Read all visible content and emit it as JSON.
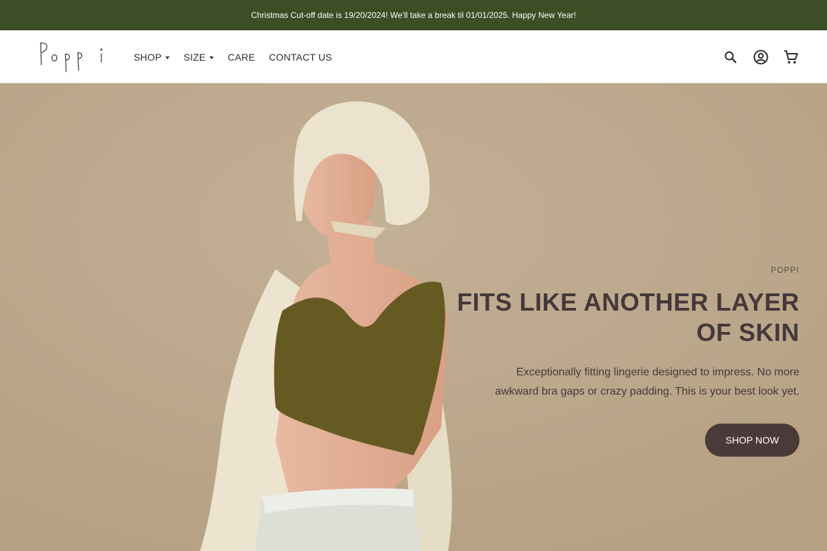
{
  "announcement": {
    "text": "Christmas Cut-off date is 19/20/2024! We'll take a break til 01/01/2025. Happy New Year!",
    "bg_color": "#3b4e25"
  },
  "brand": {
    "logo_text": "Poppi"
  },
  "nav": {
    "items": [
      {
        "label": "SHOP",
        "has_dropdown": true
      },
      {
        "label": "SIZE",
        "has_dropdown": true
      },
      {
        "label": "CARE",
        "has_dropdown": false
      },
      {
        "label": "CONTACT US",
        "has_dropdown": false
      }
    ]
  },
  "header_icons": [
    "search-icon",
    "account-icon",
    "cart-icon"
  ],
  "hero": {
    "eyebrow": "POPPI",
    "headline_line1": "FITS LIKE ANOTHER LAYER",
    "headline_line2": "OF SKIN",
    "subtext_line1": "Exceptionally fitting lingerie designed to impress. No more",
    "subtext_line2": "awkward bra gaps or crazy padding. This is your best look yet.",
    "cta_label": "SHOP NOW",
    "bg_color": "#b9a588",
    "cta_color": "#4a3a38"
  }
}
